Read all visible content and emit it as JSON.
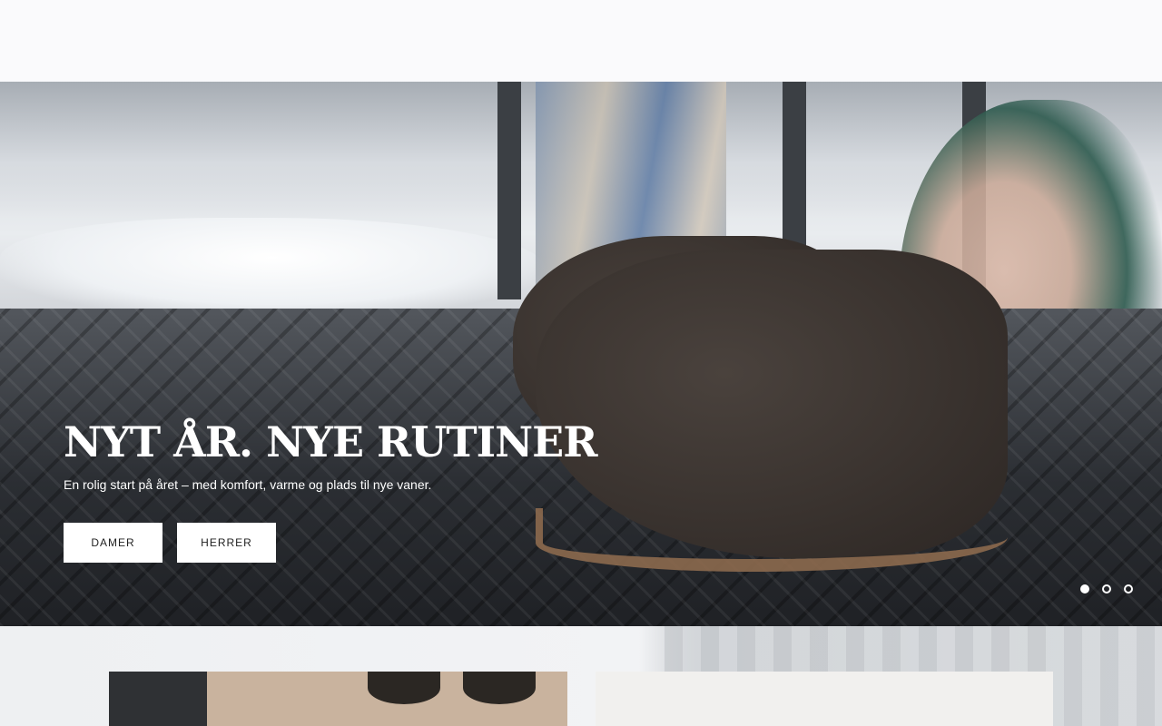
{
  "hero": {
    "title": "NYT ÅR. NYE RUTINER",
    "subtitle": "En rolig start på året – med komfort, varme og plads til nye vaner.",
    "buttons": [
      {
        "label": "DAMER"
      },
      {
        "label": "HERRER"
      }
    ],
    "carousel": {
      "slides": 3,
      "active_index": 0
    }
  },
  "colors": {
    "header_bg": "#fafafc",
    "button_bg": "#ffffff",
    "title_text": "#ffffff"
  }
}
